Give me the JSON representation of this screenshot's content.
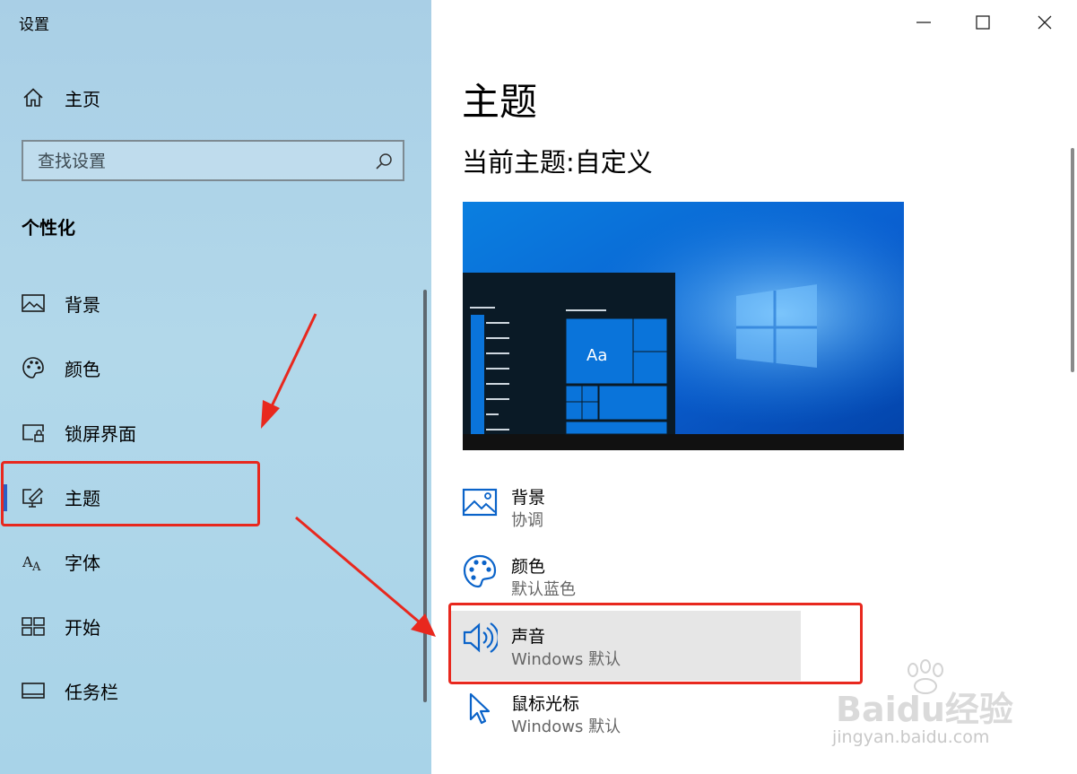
{
  "window": {
    "title": "设置"
  },
  "sidebar": {
    "home_label": "主页",
    "search_placeholder": "查找设置",
    "section_title": "个性化",
    "items": [
      {
        "label": "背景",
        "icon": "picture-icon"
      },
      {
        "label": "颜色",
        "icon": "palette-icon"
      },
      {
        "label": "锁屏界面",
        "icon": "lock-screen-icon"
      },
      {
        "label": "主题",
        "icon": "theme-brush-icon",
        "selected": true
      },
      {
        "label": "字体",
        "icon": "font-icon"
      },
      {
        "label": "开始",
        "icon": "start-icon"
      },
      {
        "label": "任务栏",
        "icon": "taskbar-icon"
      }
    ]
  },
  "main": {
    "title": "主题",
    "current_theme": "当前主题:自定义",
    "preview": {
      "sample_text": "Aa"
    },
    "options": [
      {
        "title": "背景",
        "subtitle": "协调",
        "icon": "picture-icon"
      },
      {
        "title": "颜色",
        "subtitle": "默认蓝色",
        "icon": "palette-icon"
      },
      {
        "title": "声音",
        "subtitle": "Windows 默认",
        "icon": "speaker-icon"
      },
      {
        "title": "鼠标光标",
        "subtitle": "Windows 默认",
        "icon": "cursor-icon"
      }
    ]
  },
  "watermark": {
    "main": "Baidu经验",
    "sub": "jingyan.baidu.com"
  },
  "colors": {
    "accent": "#0078d7",
    "annotation_red": "#e8281e",
    "sidebar_bg": "#a9cfe6"
  }
}
